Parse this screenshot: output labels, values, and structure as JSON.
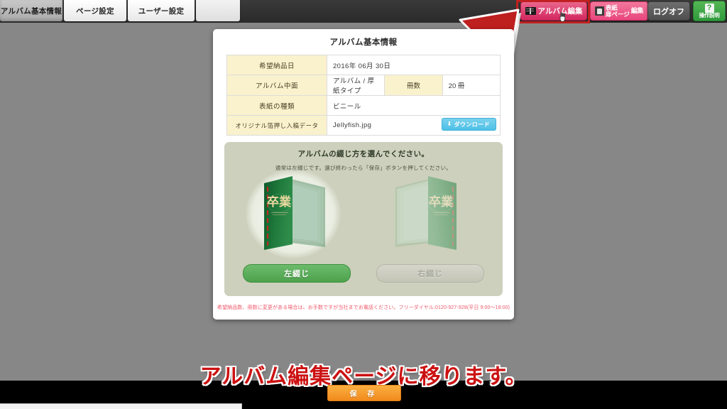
{
  "tabs": [
    {
      "label": "アルバム基本情報",
      "active": true
    },
    {
      "label": "ページ設定",
      "active": false
    },
    {
      "label": "ユーザー設定",
      "active": false
    },
    {
      "label": "",
      "active": false
    }
  ],
  "toolbar": {
    "album_edit_label": "アルバム編集",
    "cover_edit_line1": "表紙",
    "cover_edit_line2": "扉ページ",
    "cover_edit_action": "編集",
    "logoff_label": "ログオフ",
    "help_icon_label": "?",
    "help_label": "操作説明"
  },
  "panel": {
    "title": "アルバム基本情報",
    "table": {
      "rows": [
        {
          "label": "希望納品日",
          "value": "2016年 06月 30日"
        },
        {
          "label": "アルバム中面",
          "value": "アルバム / 厚紙タイプ",
          "sub_label": "冊数",
          "sub_value": "20 冊"
        },
        {
          "label": "表紙の種類",
          "value": "ビニール"
        },
        {
          "label": "オリジナル箔押し入稿データ",
          "value": "Jellyfish.jpg",
          "download_label": "ダウンロード",
          "download_icon": "download-icon"
        }
      ]
    },
    "binding": {
      "title": "アルバムの綴じ方を選んでください。",
      "subtitle": "通常は左綴じです。選び終わったら「保存」ボタンを押してください。",
      "left_button": "左綴じ",
      "right_button": "右綴じ",
      "selected": "左綴じ",
      "album_cover_text": "卒業"
    },
    "note": "希望納品数、冊数に変更がある場合は、お手数ですが当社までお電話ください。フリーダイヤル:0120-927-928(平日 9:00〜18:00)"
  },
  "caption": "アルバム編集ページに移ります。",
  "save_button": "保 存",
  "colors": {
    "desktop": "#878787",
    "accent_pink": "#d2285e",
    "accent_green": "#4da24d",
    "label_cell": "#faf2cd",
    "binding_panel": "#cdd0bc",
    "note_red": "#f0596b",
    "caption_red": "#cc1111",
    "save_orange": "#f18a1e",
    "download_blue": "#4dc0e6",
    "highlight_red": "#c0201f"
  },
  "annotation": {
    "arrow_icon": "up-right-arrow-annotation",
    "highlight_icon": "red-highlight-box",
    "cursor_icon": "pointer-hand-cursor"
  }
}
